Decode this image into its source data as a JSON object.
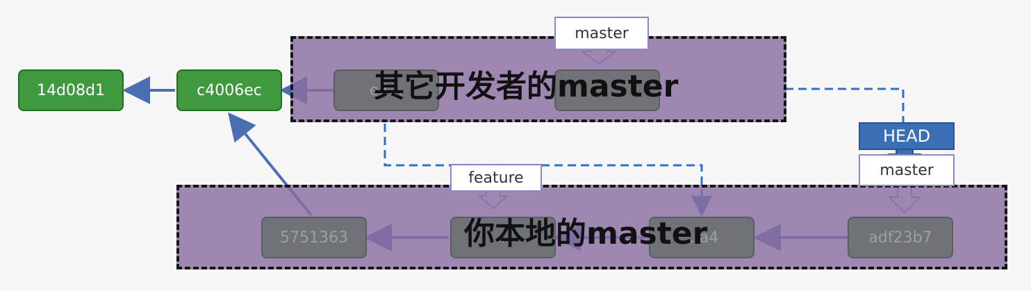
{
  "colors": {
    "commit_green": "#3f9a3f",
    "commit_grey": "#6f7378",
    "head_blue": "#3a6fb5",
    "arrow_blue": "#4a6fb3",
    "region_purple": "#8a6ea0",
    "dashed_line": "#2f6fc6"
  },
  "commits": {
    "c1": "14d08d1",
    "c2": "c4006ec",
    "other_master_prev": "e3...",
    "local_c1": "5751363",
    "local_c2": "...",
    "local_c3": "...a4",
    "local_c4": "adf23b7"
  },
  "refs": {
    "master_top": "master",
    "feature": "feature",
    "head": "HEAD",
    "master_local": "master"
  },
  "regions": {
    "other_master": "其它开发者的master",
    "local_master": "你本地的master"
  }
}
